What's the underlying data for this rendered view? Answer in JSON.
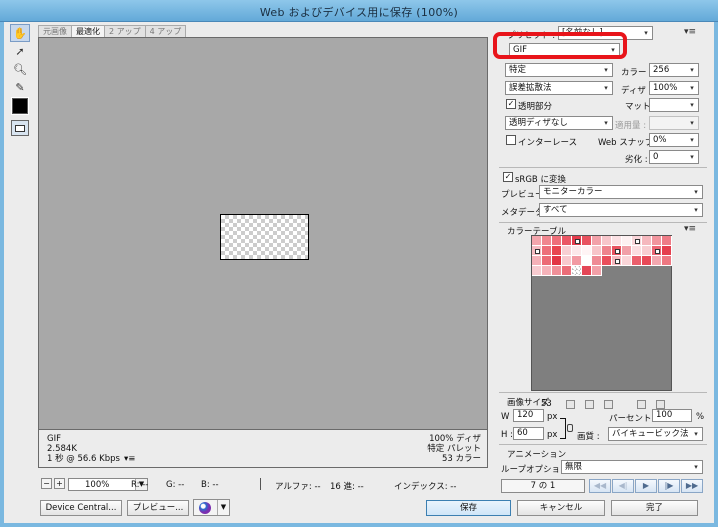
{
  "window": {
    "title": "Web およびデバイス用に保存 (100%)"
  },
  "tabs": [
    {
      "label": "元画像",
      "active": false
    },
    {
      "label": "最適化",
      "active": true
    },
    {
      "label": "2 アップ",
      "active": false
    },
    {
      "label": "4 アップ",
      "active": false
    }
  ],
  "tools": [
    "hand-icon",
    "slice-select-icon",
    "zoom-icon",
    "eyedropper-icon"
  ],
  "preview_info": {
    "format": "GIF",
    "size": "2.584K",
    "time": "1 秒 @ 56.6 Kbps",
    "dither": "100% ディザ",
    "palette": "特定 パレット",
    "colors": "53 カラー"
  },
  "status_bar": {
    "zoom": "100%",
    "r": "R: --",
    "g": "G: --",
    "b": "B: --",
    "alpha": "アルファ: --",
    "hex": "16 進: --",
    "index": "インデックス: --"
  },
  "buttons": {
    "device_central": "Device Central...",
    "preview": "プレビュー...",
    "save": "保存",
    "cancel": "キャンセル",
    "done": "完了"
  },
  "settings": {
    "preset_label": "プリセット :",
    "preset_value": "[名前なし]",
    "format": "GIF",
    "reduction": "特定",
    "colors_label": "カラー :",
    "colors_value": "256",
    "dither_algo": "誤差拡散法",
    "dither_label": "ディザ :",
    "dither_value": "100%",
    "transparency_label": "透明部分",
    "transparency_checked": true,
    "matte_label": "マット :",
    "matte_value": "",
    "trans_dither": "透明ディザなし",
    "amount_label": "適用量 :",
    "amount_value": "",
    "interlaced_label": "インターレース",
    "interlaced_checked": false,
    "websnap_label": "Web スナップ :",
    "websnap_value": "0%",
    "lossy_label": "劣化 :",
    "lossy_value": "0",
    "srgb_label": "sRGB に変換",
    "srgb_checked": true,
    "preview_label": "プレビュー :",
    "preview_value": "モニターカラー",
    "metadata_label": "メタデータ :",
    "metadata_value": "すべて"
  },
  "color_table": {
    "title": "カラーテーブル",
    "count": "53",
    "cells": [
      "#f3a6ad",
      "#f0868f",
      "#ee6f7a",
      "#ea5664",
      "#e43c4c",
      "#e8525f",
      "#f2a1a9",
      "#f7c6cb",
      "#fbe1e4",
      "#fdf1f2",
      "#f9d5d9",
      "#f5b8be",
      "#f1959e",
      "#ee7c87",
      "#f6bcc2",
      "#ed6f7a",
      "#e8454f",
      "#f8cfd3",
      "#fce8ea",
      "#fff4f5",
      "#f7c4c9",
      "#ee838d",
      "#e8525f",
      "#f1a0a8",
      "#fbdde0",
      "#f8cdd1",
      "#eb6472",
      "#e53f4e",
      "#f5b1b8",
      "#ec6b76",
      "#e23544",
      "#f8c9ce",
      "#f29aa3",
      "#ffffff",
      "#ef8b95",
      "#e94e5b",
      "#f6b7bd",
      "#fad6d9",
      "#eb5f6c",
      "#e74957",
      "#f4a8b0",
      "#ee7882",
      "#f8cbd0",
      "#f5b3ba",
      "#f09099",
      "#eb6d78",
      "#ffffff",
      "#e44757",
      "#f2a0a8"
    ],
    "dots": [
      4,
      10,
      14,
      22,
      26,
      36
    ],
    "transparent": [
      46
    ]
  },
  "image_size": {
    "title": "画像サイズ",
    "w_label": "W :",
    "w_value": "120",
    "h_label": "H :",
    "h_value": "60",
    "unit": "px",
    "percent_label": "パーセント :",
    "percent_value": "100",
    "percent_unit": "%",
    "quality_label": "画質 :",
    "quality_value": "バイキュービック法"
  },
  "animation": {
    "title": "アニメーション",
    "loop_label": "ループオプション :",
    "loop_value": "無限",
    "frame": "7 の 1"
  }
}
